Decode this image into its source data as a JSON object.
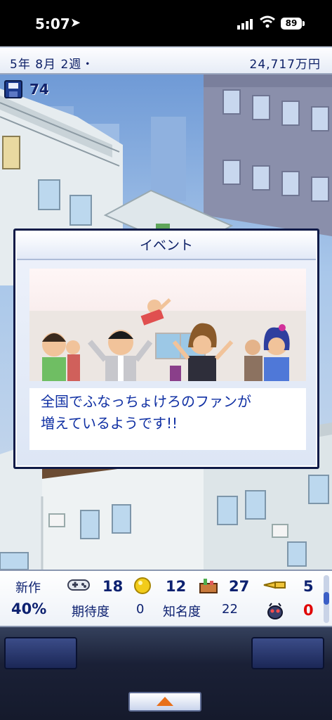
{
  "status_bar": {
    "time": "5:07",
    "battery": "89"
  },
  "header": {
    "date": "5年 8月 2週・",
    "money": "24,717万円"
  },
  "save": {
    "count": "74"
  },
  "event": {
    "title": "イベント",
    "message_line1": "全国でふなっちょけろのファンが",
    "message_line2": "増えているようです!!"
  },
  "stats": {
    "new_title_label": "新作",
    "percent": "40%",
    "expectation_label": "期待度",
    "expectation_value": "0",
    "fame_label": "知名度",
    "fame_value": "22",
    "stat1": "18",
    "stat2": "12",
    "stat3": "27",
    "stat4": "5",
    "stat5": "0"
  },
  "colors": {
    "accent": "#0c1f66",
    "message": "#0f2fa3",
    "alert": "#e00000"
  }
}
